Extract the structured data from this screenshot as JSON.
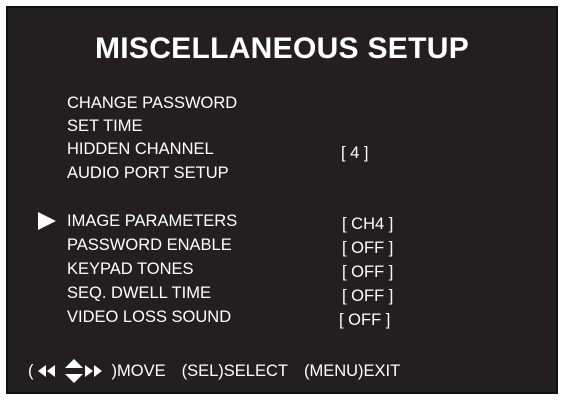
{
  "screen": {
    "title": "MISCELLANEOUS SETUP",
    "background": "#231f20",
    "text_color": "#ffffff"
  },
  "menu": {
    "items": [
      {
        "label": "CHANGE PASSWORD",
        "value": ""
      },
      {
        "label": "SET TIME",
        "value": ""
      },
      {
        "label": "HIDDEN CHANNEL",
        "value": "[   4   ]"
      },
      {
        "label": "AUDIO PORT SETUP",
        "value": ""
      },
      {
        "label": "IMAGE PARAMETERS",
        "value": "[ CH4 ]"
      },
      {
        "label": "PASSWORD ENABLE",
        "value": "[ OFF ]"
      },
      {
        "label": "KEYPAD TONES",
        "value": "[ OFF ]"
      },
      {
        "label": "SEQ. DWELL TIME",
        "value": "[ OFF ]"
      },
      {
        "label": "VIDEO LOSS SOUND",
        "value": "[  OFF  ]"
      }
    ],
    "selected_item": "IMAGE PARAMETERS",
    "cursor_icon": "triangle-right-icon"
  },
  "footer": {
    "open_paren": "(",
    "move_label": ")MOVE",
    "select_label": "(SEL)SELECT",
    "exit_label": "(MENU)EXIT",
    "nav_icon": "arrow-keys-icon"
  }
}
